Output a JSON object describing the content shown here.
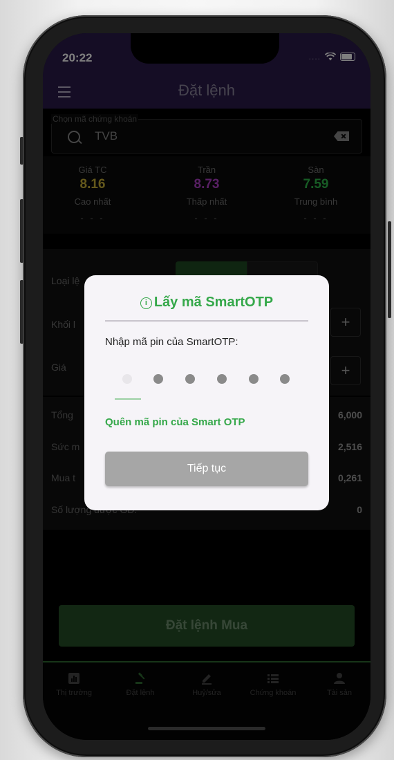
{
  "status_bar": {
    "time": "20:22",
    "signal": "...."
  },
  "app_bar": {
    "title": "Đặt lệnh"
  },
  "search": {
    "label": "Chọn mã chứng khoán",
    "value": "TVB"
  },
  "prices": {
    "ref_label": "Giá TC",
    "ref_value": "8.16",
    "ceil_label": "Trần",
    "ceil_value": "8.73",
    "floor_label": "Sàn",
    "floor_value": "7.59",
    "high_label": "Cao nhất",
    "high_value": "- - -",
    "low_label": "Thấp nhất",
    "low_value": "- - -",
    "avg_label": "Trung bình",
    "avg_value": "- - -",
    "colors": {
      "ref": "#c9b037",
      "ceil": "#b040c8",
      "floor": "#2fb84a"
    }
  },
  "order_form": {
    "order_type_label": "Loại lệ",
    "volume_label": "Khối l",
    "price_label": "Giá",
    "plus": "+"
  },
  "summary": {
    "total_label": "Tổng",
    "total_value": "6,000",
    "power_label": "Sức m",
    "power_value": "2,516",
    "buy_label": "Mua t",
    "buy_value": "0,261",
    "qty_label": "Số lượng được GD:",
    "qty_value": "0"
  },
  "place_button": "Đặt lệnh Mua",
  "tabs": [
    {
      "label": "Thị trường",
      "icon": "chart-icon"
    },
    {
      "label": "Đặt lệnh",
      "icon": "gavel-icon"
    },
    {
      "label": "Huỷ/sửa",
      "icon": "edit-icon"
    },
    {
      "label": "Chứng khoán",
      "icon": "list-icon"
    },
    {
      "label": "Tài sản",
      "icon": "person-icon"
    }
  ],
  "dialog": {
    "title": "Lấy mã SmartOTP",
    "info_glyph": "i",
    "prompt": "Nhập mã pin của SmartOTP:",
    "forgot": "Quên mã pin của Smart OTP",
    "continue": "Tiếp tục",
    "pin_length": 6,
    "accent": "#35a84a"
  }
}
